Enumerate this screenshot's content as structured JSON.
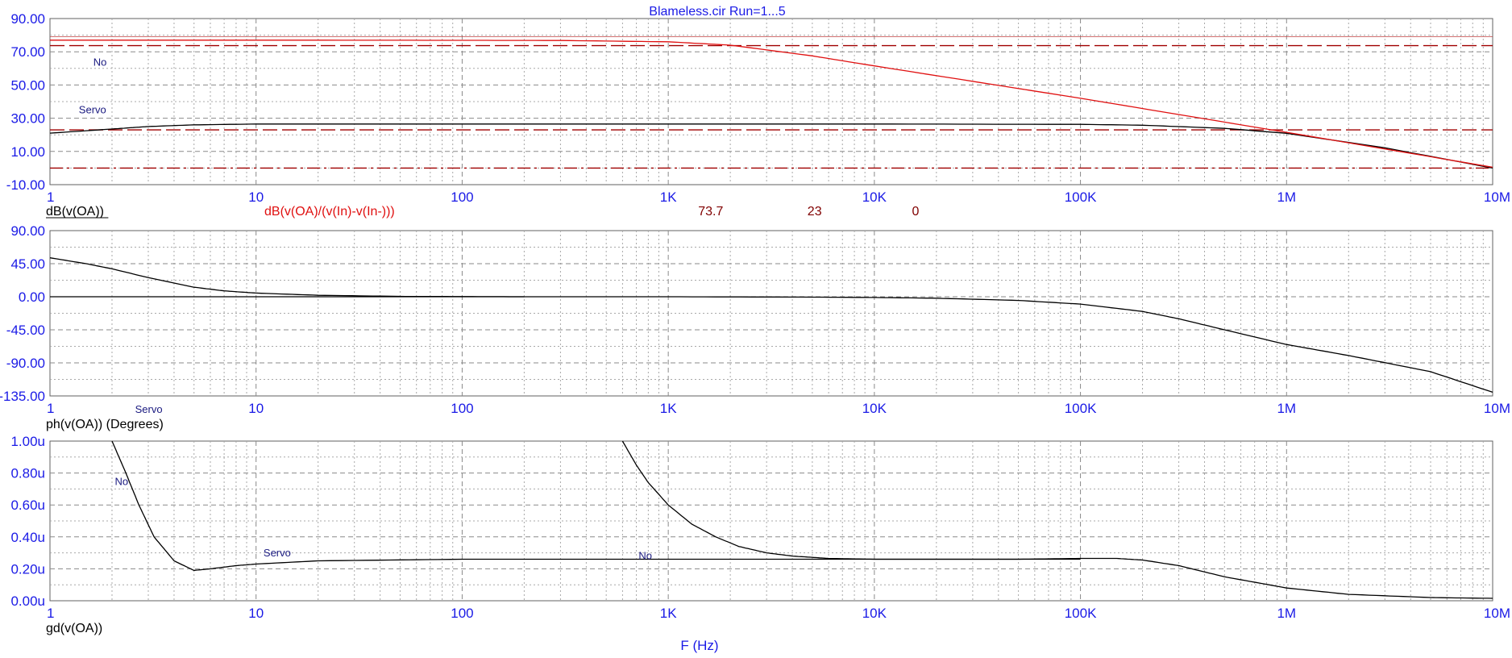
{
  "title": "Blameless.cir Run=1...5",
  "x_axis_label": "F (Hz)",
  "colors": {
    "axis_text": "#1a1ae6",
    "trace": "#000000",
    "open_loop": "#e01010",
    "markers": "#a00000",
    "grid": "#9a9a9a",
    "annotation": "#1a1a80"
  },
  "chart_data": [
    {
      "type": "line",
      "name": "magnitude",
      "ylabel": "dB(v(OA))",
      "secondary_label": "dB(v(OA)/(v(In)-v(In-)))",
      "x_scale": "log",
      "xlim": [
        1,
        10000000
      ],
      "x_ticks": [
        "1",
        "10",
        "100",
        "1K",
        "10K",
        "100K",
        "1M",
        "10M"
      ],
      "ylim": [
        -10,
        90
      ],
      "y_ticks": [
        "90.00",
        "70.00",
        "50.00",
        "30.00",
        "10.00",
        "-10.00"
      ],
      "markers": [
        {
          "label": "73.7",
          "value": 73.7,
          "style": "dashed"
        },
        {
          "label": "23",
          "value": 23,
          "style": "dashed"
        },
        {
          "label": "0",
          "value": 0,
          "style": "dashdot"
        }
      ],
      "annotations": [
        "Servo",
        "No"
      ],
      "series": [
        {
          "name": "dB(v(OA))",
          "color": "#000000",
          "x": [
            1,
            2,
            3,
            5,
            10,
            100,
            1000,
            10000,
            100000,
            200000,
            500000,
            1000000,
            3000000,
            10000000
          ],
          "y": [
            21,
            23.5,
            25,
            26,
            26.5,
            26.5,
            26.5,
            26.5,
            26.3,
            25.8,
            23.9,
            20.9,
            12.2,
            0
          ]
        },
        {
          "name": "dB(v(OA)/(v(In)-v(In-)))",
          "color": "#e01010",
          "x": [
            1,
            10,
            100,
            300,
            1000,
            2000,
            5000,
            10000,
            100000,
            1000000,
            10000000
          ],
          "y": [
            77,
            77,
            76.9,
            76.8,
            76,
            74,
            67.5,
            61.5,
            42,
            21.5,
            0.5
          ]
        }
      ]
    },
    {
      "type": "line",
      "name": "phase",
      "ylabel": "ph(v(OA)) (Degrees)",
      "x_scale": "log",
      "xlim": [
        1,
        10000000
      ],
      "x_ticks": [
        "1",
        "10",
        "100",
        "1K",
        "10K",
        "100K",
        "1M",
        "10M"
      ],
      "ylim": [
        -135,
        90
      ],
      "y_ticks": [
        "90.00",
        "45.00",
        "0.00",
        "-45.00",
        "-90.00",
        "-135.00"
      ],
      "annotations": [
        "No",
        "Servo"
      ],
      "series": [
        {
          "name": "No",
          "color": "#000000",
          "x": [
            1,
            1.5,
            2,
            3,
            5,
            7,
            10,
            20,
            50,
            100,
            200
          ],
          "y": [
            53,
            45,
            38,
            26,
            13,
            8,
            5,
            2,
            0.5,
            0.2,
            0
          ]
        },
        {
          "name": "ph(v(OA))",
          "color": "#000000",
          "x": [
            1,
            10,
            100,
            1000,
            5000,
            10000,
            20000,
            50000,
            100000,
            200000,
            300000,
            500000,
            1000000,
            2000000,
            5000000,
            10000000
          ],
          "y": [
            0,
            0,
            0,
            0,
            -0.5,
            -1,
            -2,
            -5,
            -10,
            -20,
            -30,
            -45,
            -65,
            -80,
            -102,
            -130
          ]
        }
      ]
    },
    {
      "type": "line",
      "name": "group-delay",
      "ylabel": "gd(v(OA))",
      "x_scale": "log",
      "xlim": [
        1,
        10000000
      ],
      "x_ticks": [
        "1",
        "10",
        "100",
        "1K",
        "10K",
        "100K",
        "1M",
        "10M"
      ],
      "ylim": [
        0,
        1
      ],
      "y_ticks": [
        "1.00u",
        "0.80u",
        "0.60u",
        "0.40u",
        "0.20u",
        "0.00u"
      ],
      "y_unit": "u",
      "annotations": [
        "Servo",
        "No"
      ],
      "series": [
        {
          "name": "Servo",
          "color": "#000000",
          "x": [
            2,
            2.3,
            2.7,
            3.2,
            4,
            5,
            6,
            8,
            10,
            20,
            100,
            1000,
            10000,
            50000,
            100000,
            150000,
            200000,
            300000,
            500000,
            1000000,
            2000000,
            5000000,
            10000000
          ],
          "y": [
            1.0,
            0.82,
            0.6,
            0.4,
            0.25,
            0.19,
            0.2,
            0.22,
            0.23,
            0.25,
            0.26,
            0.26,
            0.26,
            0.26,
            0.265,
            0.265,
            0.255,
            0.22,
            0.15,
            0.08,
            0.04,
            0.02,
            0.015
          ]
        },
        {
          "name": "No",
          "color": "#000000",
          "x": [
            600,
            700,
            800,
            1000,
            1300,
            1700,
            2200,
            3000,
            4000,
            6000,
            10000,
            50000,
            100000
          ],
          "y": [
            1.0,
            0.85,
            0.74,
            0.6,
            0.48,
            0.4,
            0.34,
            0.3,
            0.28,
            0.265,
            0.26,
            0.26,
            0.26
          ]
        }
      ]
    }
  ]
}
